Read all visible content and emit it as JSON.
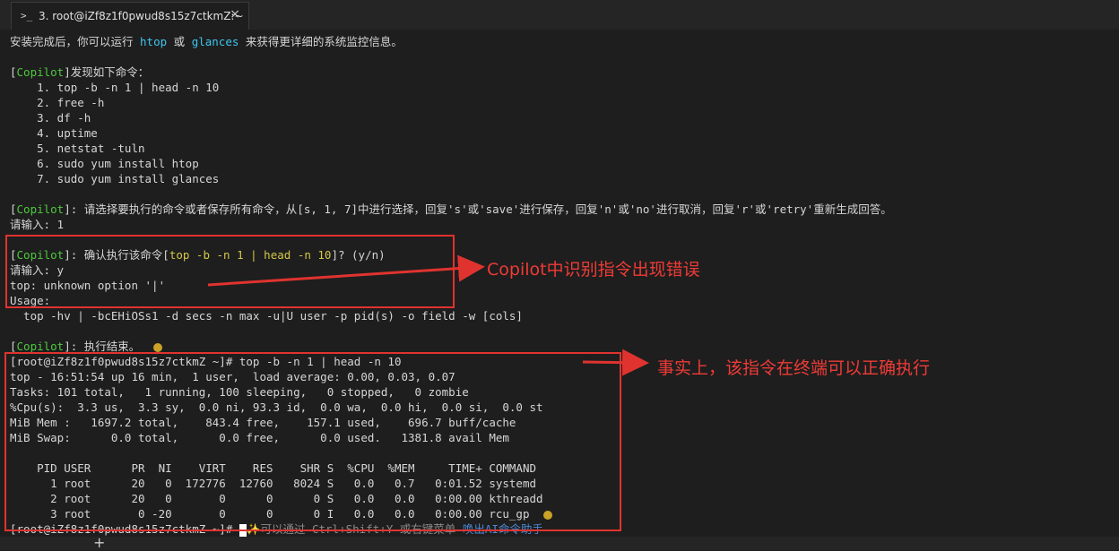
{
  "tab": {
    "prompt_icon": "terminal-prompt-icon",
    "title": "3. root@iZf8z1f0pwud8s15z7ctkmZ:~",
    "close": "×"
  },
  "lines": {
    "l1": {
      "a": "安装完成后，你可以运行 ",
      "b": "htop",
      "c": " 或 ",
      "d": "glances",
      "e": " 来获得更详细的系统监控信息。"
    },
    "l2": {
      "a": "[",
      "b": "Copilot",
      "c": "]发现如下命令："
    },
    "cmds": [
      "    1. top -b -n 1 | head -n 10",
      "    2. free -h",
      "    3. df -h",
      "    4. uptime",
      "    5. netstat -tuln",
      "    6. sudo yum install htop",
      "    7. sudo yum install glances"
    ],
    "l3": {
      "a": "[",
      "b": "Copilot",
      "c": "]: 请选择要执行的命令或者保存所有命令，从[s, 1, 7]中进行选择，回复's'或'save'进行保存，回复'n'或'no'进行取消，回复'r'或'retry'重新生成回答。"
    },
    "l4": "请输入: 1",
    "l5": {
      "a": "[",
      "b": "Copilot",
      "c": "]: 确认执行该命令[",
      "d": "top -b -n 1 | head -n 10",
      "e": "]? (y/n)"
    },
    "l6": "请输入: y",
    "l7": "top: unknown option '|'",
    "l8": "Usage:",
    "l9": "  top -hv | -bcEHiOSs1 -d secs -n max -u|U user -p pid(s) -o field -w [cols]",
    "l10": {
      "a": "[",
      "b": "Copilot",
      "c": "]: 执行结束。"
    },
    "l11": "[root@iZf8z1f0pwud8s15z7ctkmZ ~]# top -b -n 1 | head -n 10",
    "l12": "top - 16:51:54 up 16 min,  1 user,  load average: 0.00, 0.03, 0.07",
    "l13": "Tasks: 101 total,   1 running, 100 sleeping,   0 stopped,   0 zombie",
    "l14": "%Cpu(s):  3.3 us,  3.3 sy,  0.0 ni, 93.3 id,  0.0 wa,  0.0 hi,  0.0 si,  0.0 st",
    "l15": "MiB Mem :   1697.2 total,    843.4 free,    157.1 used,    696.7 buff/cache",
    "l16": "MiB Swap:      0.0 total,      0.0 free,      0.0 used.   1381.8 avail Mem",
    "l17": "    PID USER      PR  NI    VIRT    RES    SHR S  %CPU  %MEM     TIME+ COMMAND",
    "procs": [
      "      1 root      20   0  172776  12760   8024 S   0.0   0.7   0:01.52 systemd",
      "      2 root      20   0       0      0      0 S   0.0   0.0   0:00.00 kthreadd",
      "      3 root       0 -20       0      0      0 I   0.0   0.0   0:00.00 rcu_gp"
    ],
    "prompt": "[root@iZf8z1f0pwud8s15z7ctkmZ ~]# ",
    "hint": "✨可以通过 Ctrl+Shift+Y 或右键菜单 ",
    "hint_link": "唤出AI命令助手"
  },
  "annotations": {
    "note1": "Copilot中识别指令出现错误",
    "note2": "事实上，该指令在终端可以正确执行",
    "color": "#e0332f"
  },
  "bottom": {
    "plus": "+"
  }
}
